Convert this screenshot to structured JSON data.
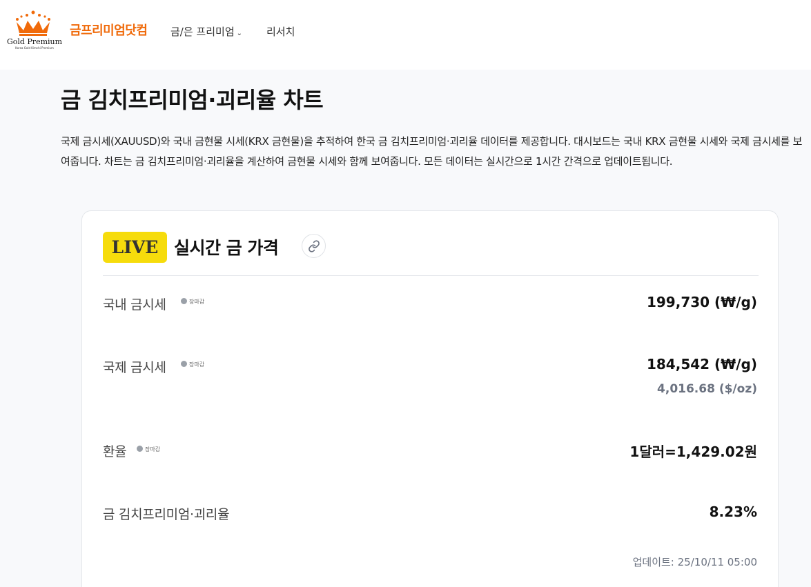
{
  "header": {
    "logo_text": "Gold Premium",
    "logo_subtext": "Korea Gold Kimchi Premium",
    "brand": "금프리미엄닷컴",
    "nav": [
      {
        "label": "금/은 프리미엄"
      },
      {
        "label": "리서치"
      }
    ]
  },
  "page": {
    "title": "금 김치프리미엄·괴리율 차트",
    "intro": "국제 금시세(XAUUSD)와 국내 금현물 시세(KRX 금현물)을 추적하여 한국 금 김치프리미엄·괴리율 데이터를 제공합니다. 대시보드는 국내 KRX 금현물 시세와 국제 금시세를 보여줍니다. 차트는 금 김치프리미엄·괴리율을 계산하여 금현물 시세와 함께 보여줍니다. 모든 데이터는 실시간으로 1시간 간격으로 업데이트됩니다."
  },
  "card": {
    "badge": "LIVE",
    "title": "실시간 금 가격",
    "rows": [
      {
        "label": "국내 금시세",
        "status": "장마감",
        "value": "199,730 (₩/g)"
      },
      {
        "label": "국제 금시세",
        "status": "장마감",
        "value": "184,542 (₩/g)",
        "sub_value": "4,016.68 ($/oz)"
      },
      {
        "label": "환율",
        "status": "장마감",
        "value": "1달러=1,429.02원"
      },
      {
        "label": "금 김치프리미엄·괴리율",
        "value": "8.23%"
      }
    ],
    "updated": "업데이트: 25/10/11 05:00"
  },
  "colors": {
    "brand": "#f06a0a",
    "live_badge": "#f6dc0c",
    "status_dot": "#9aa0a8",
    "page_bg": "#f8f9fb"
  },
  "icons": [
    "crown-logo-icon",
    "chevron-down-icon",
    "link-icon"
  ]
}
